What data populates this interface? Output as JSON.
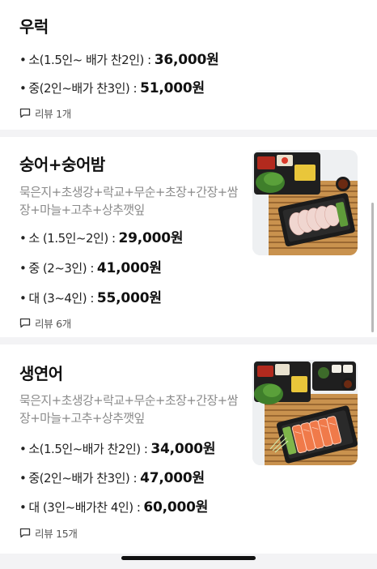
{
  "menu_items": [
    {
      "title": "우럭",
      "prices": [
        {
          "label": "소(1.5인~ 배가 찬2인) :",
          "amount": "36,000원"
        },
        {
          "label": "중(2인~배가 찬3인) :",
          "amount": "51,000원"
        }
      ],
      "review": "리뷰 1개"
    },
    {
      "title": "숭어+숭어밤",
      "description": "묵은지+초생강+락교+무순+초장+간장+쌈장+마늘+고추+상추깻잎",
      "prices": [
        {
          "label": "소 (1.5인~2인) :",
          "amount": "29,000원"
        },
        {
          "label": "중 (2~3인) :",
          "amount": "41,000원"
        },
        {
          "label": "대 (3~4인) :",
          "amount": "55,000원"
        }
      ],
      "review": "리뷰 6개",
      "image": "sashimi-platter-white-fish"
    },
    {
      "title": "생연어",
      "description": "묵은지+초생강+락교+무순+초장+간장+쌈장+마늘+고추+상추깻잎",
      "prices": [
        {
          "label": "소(1.5인~배가 찬2인) :",
          "amount": "34,000원"
        },
        {
          "label": "중(2인~배가 찬3인) :",
          "amount": "47,000원"
        },
        {
          "label": "대 (3인~배가찬 4인) :",
          "amount": "60,000원"
        }
      ],
      "review": "리뷰 15개",
      "image": "salmon-sashimi-platter"
    }
  ],
  "bullet": "•",
  "icons": {
    "review": "speech-bubble-icon"
  },
  "colors": {
    "text": "#111111",
    "muted": "#8b8b8b",
    "separator": "#f3f3f5"
  }
}
